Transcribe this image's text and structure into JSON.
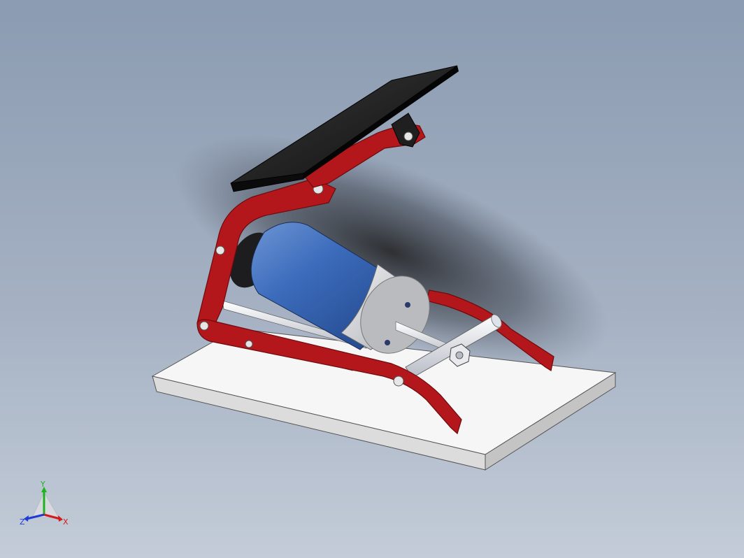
{
  "viewport": {
    "background_top": "#8b9bb1",
    "background_bottom": "#c3ccd8"
  },
  "model": {
    "colors": {
      "frame": "#b3171b",
      "frame_edge": "#6e0b0d",
      "pedal": "#1c1c1c",
      "cylinder": "#2f5fb0",
      "cap": "#d9dadd",
      "base": "#f4f4f4",
      "rod": "#e6e8ee"
    }
  },
  "triad": {
    "x_label": "X",
    "y_label": "Y",
    "z_label": "Z",
    "x_color": "#d21b1b",
    "y_color": "#1fb31f",
    "z_color": "#1f3bd6"
  }
}
